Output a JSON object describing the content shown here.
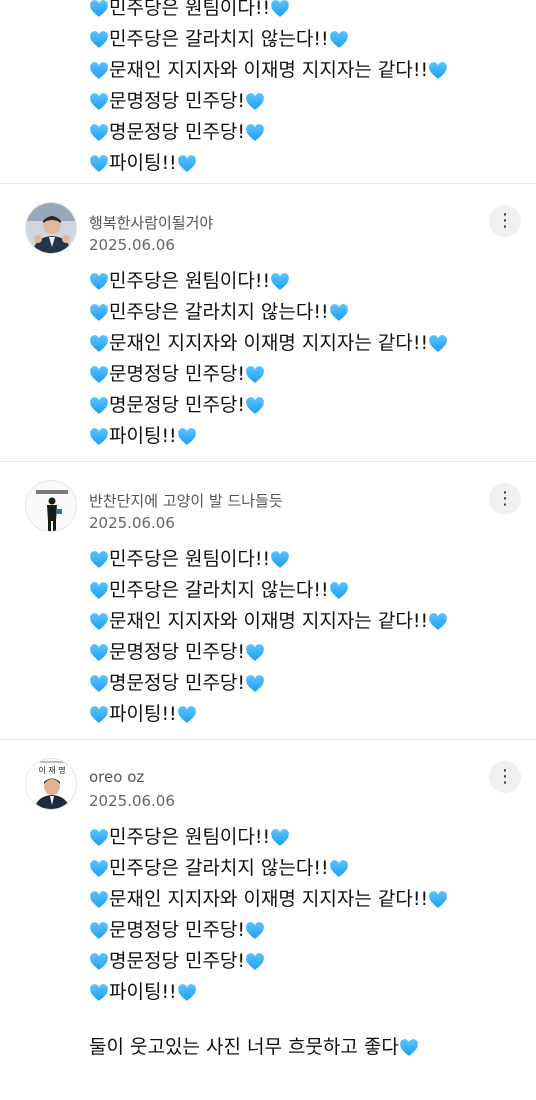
{
  "colors": {
    "heart": "#1e9ff2",
    "divider": "#e9e9e9",
    "date": "#666666"
  },
  "comments": [
    {
      "author": "",
      "date": "",
      "avatar": "",
      "lines": [
        "민주당은 원팀이다!!",
        "민주당은 갈라치지 않는다!!",
        "문재인 지지자와 이재명 지지자는 같다!!",
        "문명정당 민주당!",
        "명문정당 민주당!",
        "파이팅!!"
      ]
    },
    {
      "author": "행복한사람이될거야",
      "date": "2025.06.06",
      "avatar": "photo-person-thumbs-up",
      "lines": [
        "민주당은 원팀이다!!",
        "민주당은 갈라치지 않는다!!",
        "문재인 지지자와 이재명 지지자는 같다!!",
        "문명정당 민주당!",
        "명문정당 민주당!",
        "파이팅!!"
      ]
    },
    {
      "author": "반찬단지에 고양이 발 드나들듯",
      "date": "2025.06.06",
      "avatar": "standing-figure",
      "lines": [
        "민주당은 원팀이다!!",
        "민주당은 갈라치지 않는다!!",
        "문재인 지지자와 이재명 지지자는 같다!!",
        "문명정당 민주당!",
        "명문정당 민주당!",
        "파이팅!!"
      ]
    },
    {
      "author": "oreo oz",
      "date": "2025.06.06",
      "avatar": "portrait-with-nameplate",
      "avatar_text": "이 재 명",
      "lines": [
        "민주당은 원팀이다!!",
        "민주당은 갈라치지 않는다!!",
        "문재인 지지자와 이재명 지지자는 같다!!",
        "문명정당 민주당!",
        "명문정당 민주당!",
        "파이팅!!"
      ],
      "extra": "둘이 웃고있는 사진 너무 흐뭇하고 좋다"
    }
  ]
}
